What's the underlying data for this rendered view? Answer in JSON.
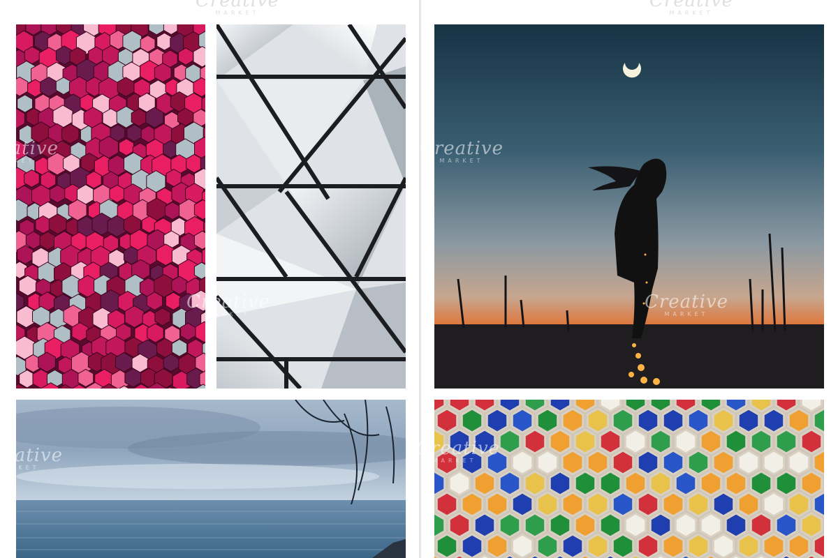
{
  "watermark": {
    "brand": "Creative",
    "sub": "MARKET"
  },
  "photos": [
    {
      "name": "pink-sequins-photo"
    },
    {
      "name": "white-geometric-panels-photo"
    },
    {
      "name": "silhouette-sunset-photo"
    },
    {
      "name": "ocean-horizon-photo"
    },
    {
      "name": "colorful-glass-tiles-photo"
    }
  ]
}
